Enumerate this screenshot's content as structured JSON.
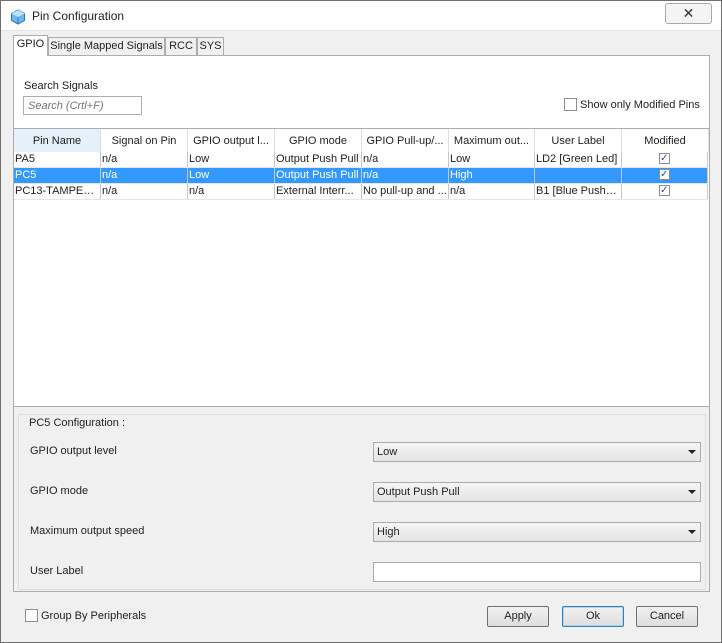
{
  "window": {
    "title": "Pin Configuration",
    "close_glyph": "✕"
  },
  "tabs": [
    {
      "label": "GPIO",
      "active": true
    },
    {
      "label": "Single Mapped Signals",
      "active": false
    },
    {
      "label": "RCC",
      "active": false
    },
    {
      "label": "SYS",
      "active": false
    }
  ],
  "search": {
    "label": "Search Signals",
    "placeholder": "Search (Crtl+F)"
  },
  "show_modified": {
    "label": "Show only Modified Pins",
    "checked": false
  },
  "table": {
    "columns": [
      "Pin Name",
      "Signal on Pin",
      "GPIO output l...",
      "GPIO mode",
      "GPIO Pull-up/...",
      "Maximum out...",
      "User Label",
      "Modified"
    ],
    "sorted_column": "Pin Name",
    "rows": [
      {
        "pin": "PA5",
        "signal": "n/a",
        "output_level": "Low",
        "mode": "Output Push Pull",
        "pull": "n/a",
        "speed": "Low",
        "label": "LD2 [Green Led]",
        "modified": true,
        "selected": false
      },
      {
        "pin": "PC5",
        "signal": "n/a",
        "output_level": "Low",
        "mode": "Output Push Pull",
        "pull": "n/a",
        "speed": "High",
        "label": "",
        "modified": true,
        "selected": true
      },
      {
        "pin": "PC13-TAMPER...",
        "signal": "n/a",
        "output_level": "n/a",
        "mode": "External Interr...",
        "pull": "No pull-up and ...",
        "speed": "n/a",
        "label": "B1 [Blue PushB...",
        "modified": true,
        "selected": false
      }
    ]
  },
  "config": {
    "title": "PC5 Configuration :",
    "output_level_label": "GPIO output level",
    "output_level_value": "Low",
    "mode_label": "GPIO mode",
    "mode_value": "Output Push Pull",
    "speed_label": "Maximum output speed",
    "speed_value": "High",
    "user_label_label": "User Label",
    "user_label_value": ""
  },
  "footer": {
    "group_by_label": "Group By Peripherals",
    "group_by_checked": false,
    "apply": "Apply",
    "ok": "Ok",
    "cancel": "Cancel"
  },
  "colors": {
    "selection": "#3399ff",
    "app_icon": "#3a8fd6"
  }
}
